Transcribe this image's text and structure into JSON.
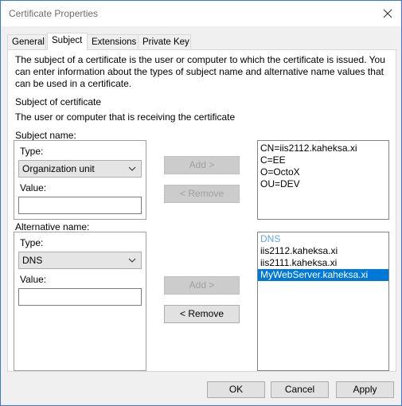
{
  "window": {
    "title": "Certificate Properties"
  },
  "tabs": [
    {
      "label": "General"
    },
    {
      "label": "Subject"
    },
    {
      "label": "Extensions"
    },
    {
      "label": "Private Key"
    }
  ],
  "subject_tab": {
    "description": "The subject of a certificate is the user or computer to which the certificate is issued. You can enter information about the types of subject name and alternative name values that can be used in a certificate.",
    "section_heading": "Subject of certificate",
    "section_sub": "The user or computer that is receiving the certificate",
    "subject_name": {
      "label": "Subject name:",
      "type_label": "Type:",
      "type_value": "Organization unit",
      "value_label": "Value:",
      "value_text": "",
      "add_button": "Add >",
      "remove_button": "< Remove",
      "list": [
        "CN=iis2112.kaheksa.xi",
        "C=EE",
        "O=OctoX",
        "OU=DEV"
      ]
    },
    "alternative_name": {
      "label": "Alternative name:",
      "type_label": "Type:",
      "type_value": "DNS",
      "value_label": "Value:",
      "value_text": "",
      "add_button": "Add >",
      "remove_button": "< Remove",
      "list_header": "DNS",
      "list": [
        "iis2112.kaheksa.xi",
        "iis2111.kaheksa.xi",
        "MyWebServer.kaheksa.xi"
      ],
      "selected_item": "MyWebServer.kaheksa.xi"
    }
  },
  "footer": {
    "ok": "OK",
    "cancel": "Cancel",
    "apply": "Apply"
  },
  "colors": {
    "selection": "#0078d7",
    "list_header": "#61a8e0",
    "window_border": "#3b78d4"
  }
}
